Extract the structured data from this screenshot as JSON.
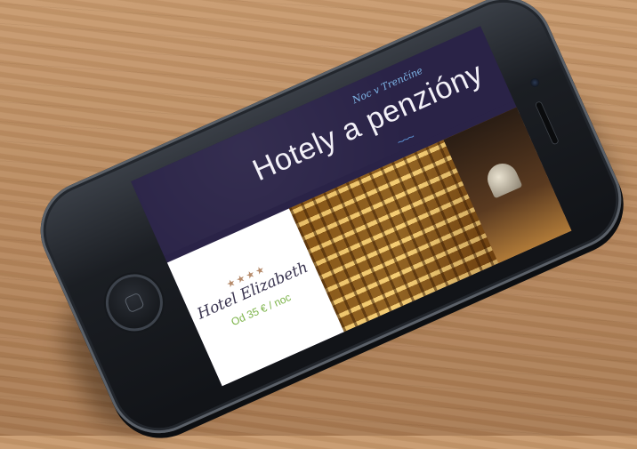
{
  "screen": {
    "header": {
      "subtitle": "Noc v Trenčíne",
      "title": "Hotely a penzióny",
      "wave": "~~~"
    },
    "card": {
      "stars": "★★★★",
      "name": "Hotel Elizabeth",
      "price": "Od 35 € / noc"
    }
  },
  "colors": {
    "screen_bg": "#2a2347",
    "subtitle": "#7fb6e8",
    "price": "#7db44a",
    "stars": "#b58a6a"
  }
}
